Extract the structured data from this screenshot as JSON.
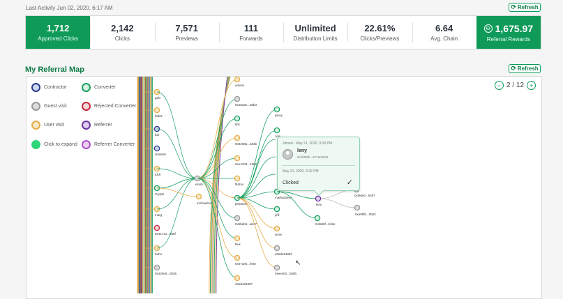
{
  "header": {
    "last_activity": "Last Activity Jun 02, 2020, 6:17 AM",
    "refresh_label": "Refresh"
  },
  "stats": [
    {
      "value": "1,712",
      "label": "Approved Clicks",
      "highlight": true
    },
    {
      "value": "2,142",
      "label": "Clicks",
      "highlight": false
    },
    {
      "value": "7,571",
      "label": "Previews",
      "highlight": false
    },
    {
      "value": "111",
      "label": "Forwards",
      "highlight": false
    },
    {
      "value": "Unlimited",
      "label": "Distribution Limits",
      "highlight": false
    },
    {
      "value": "22.61%",
      "label": "Clicks/Previews",
      "highlight": false
    },
    {
      "value": "6.64",
      "label": "Avg. Chain",
      "highlight": false
    },
    {
      "value": "1,675.97",
      "label": "Referral Rewards",
      "highlight": true,
      "icon": "reward-icon"
    }
  ],
  "map": {
    "title": "My Referral Map",
    "refresh_label": "Refresh",
    "page_indicator": "2 / 12",
    "prev_icon": "minus-icon",
    "next_icon": "plus-icon",
    "legend": [
      {
        "label": "Contractor",
        "border": "#2a3a8c",
        "fill": "#cfd8f0"
      },
      {
        "label": "Converter",
        "border": "#18a060",
        "fill": "#d7f2e3"
      },
      {
        "label": "Guest visit",
        "border": "#9a9a9a",
        "fill": "#dcdcdc"
      },
      {
        "label": "Rejected Converter",
        "border": "#c8283a",
        "fill": "#f4d7da"
      },
      {
        "label": "User visit",
        "border": "#e5ad4a",
        "fill": "#f6e8c6"
      },
      {
        "label": "Referrer",
        "border": "#6a34a0",
        "fill": "#dfcff0"
      },
      {
        "label": "Click to expand",
        "border": "#2ed67a",
        "fill": "#2ed67a"
      },
      {
        "label": "Referrer Converter",
        "border": "#b050d0",
        "fill": "#ecd3f4"
      }
    ],
    "node_labels": {
      "left": [
        "galv",
        "faifaz",
        "bar",
        "dnskhet",
        "tdch",
        "Crypto",
        "murg",
        "0x41741...589f",
        "hoho",
        "0x425e5...0935"
      ],
      "mid": [
        "elosh",
        "michaeliso"
      ],
      "col3": [
        "arielos",
        "0x45a3e...58b3",
        "link",
        "0x9e06b...a93b",
        "0xe4109...1962",
        "fitahui",
        "phantom",
        "0xbbeb6...ab37",
        "Buk",
        "0x073e5...fe50",
        "ohad181987"
      ],
      "col4": [
        "pinoy",
        "Jels",
        "markandeyo",
        "jeff",
        "arnie",
        "ohad181987",
        "0xee462...b60b"
      ],
      "right": [
        "leny",
        "0xfa6e0...5497",
        "0xa99fb...0b62",
        "0xfa95f...b1be"
      ]
    },
    "tooltip": {
      "joined": "Joined - May 21, 2020, 3:39 PM",
      "name": "leny",
      "address": "0xf1f0f0b...6715c0b39",
      "date": "May 21, 2020, 3:42 PM",
      "status": "Clicked"
    }
  },
  "colors": {
    "brand_green": "#109a5a",
    "title_green": "#0d7a45"
  }
}
